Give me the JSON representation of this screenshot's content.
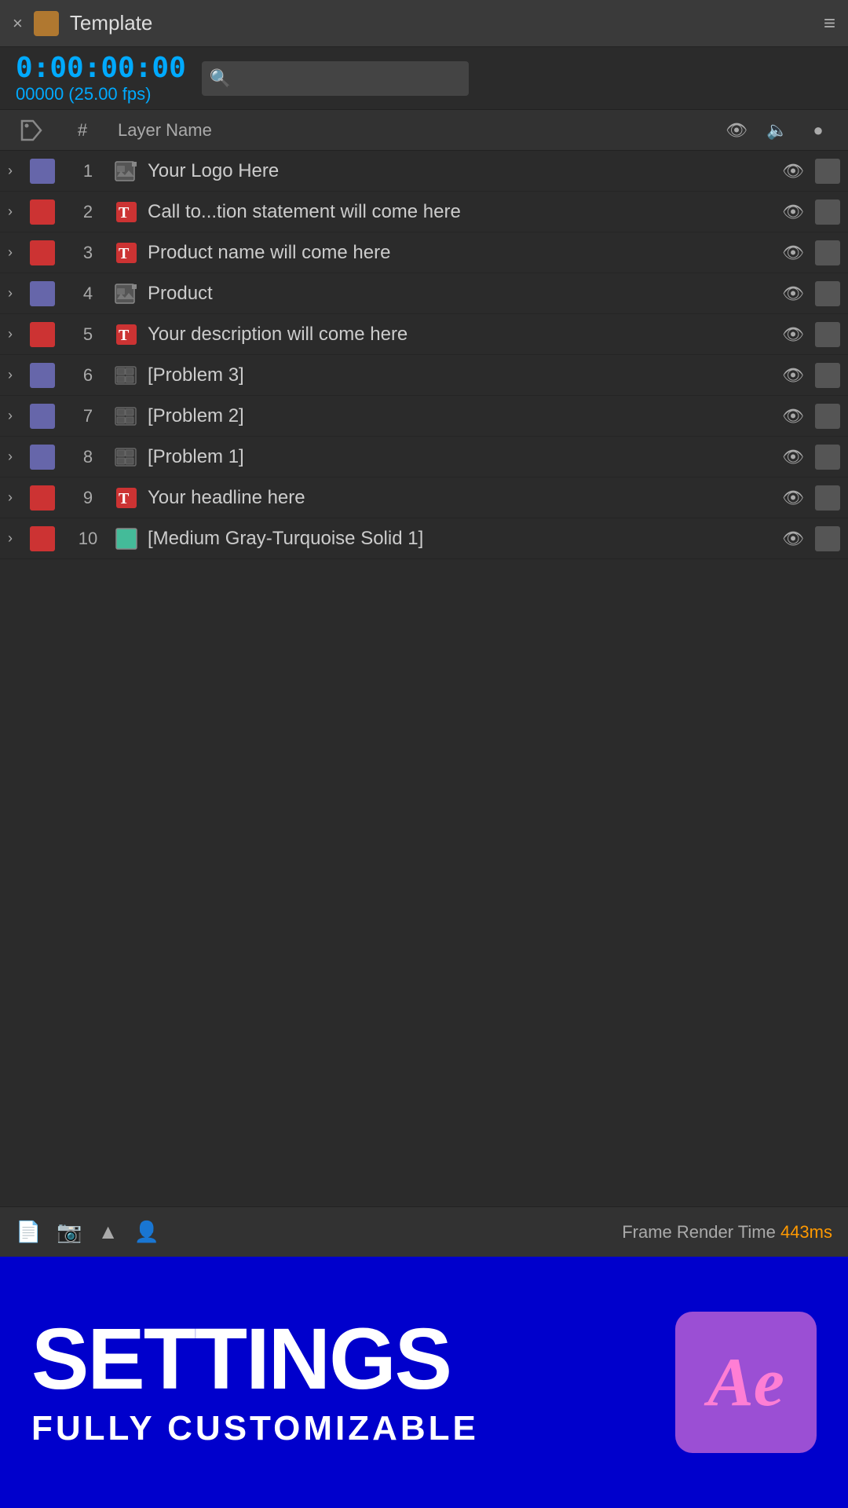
{
  "titleBar": {
    "close": "×",
    "title": "Template",
    "menuIcon": "≡"
  },
  "timecode": {
    "main": "0:00:00:00",
    "sub": "00000 (25.00 fps)"
  },
  "search": {
    "placeholder": ""
  },
  "columnHeaders": {
    "hash": "#",
    "layerName": "Layer Name"
  },
  "layers": [
    {
      "num": "1",
      "color": "#6666aa",
      "type": "image",
      "name": "Your Logo Here",
      "hasEye": true
    },
    {
      "num": "2",
      "color": "#cc3333",
      "type": "text",
      "name": "Call to...tion statement will come here",
      "hasEye": true
    },
    {
      "num": "3",
      "color": "#cc3333",
      "type": "text",
      "name": "Product name will come here",
      "hasEye": true
    },
    {
      "num": "4",
      "color": "#6666aa",
      "type": "image",
      "name": "Product",
      "hasEye": true
    },
    {
      "num": "5",
      "color": "#cc3333",
      "type": "text",
      "name": "Your description will come here",
      "hasEye": true
    },
    {
      "num": "6",
      "color": "#6666aa",
      "type": "precomp",
      "name": "[Problem 3]",
      "hasEye": true
    },
    {
      "num": "7",
      "color": "#6666aa",
      "type": "precomp",
      "name": "[Problem 2]",
      "hasEye": true
    },
    {
      "num": "8",
      "color": "#6666aa",
      "type": "precomp",
      "name": "[Problem 1]",
      "hasEye": true
    },
    {
      "num": "9",
      "color": "#cc3333",
      "type": "text",
      "name": "Your headline here",
      "hasEye": true
    },
    {
      "num": "10",
      "color": "#cc3333",
      "type": "solid",
      "solidColor": "#44bb99",
      "name": "[Medium Gray-Turquoise Solid 1]",
      "hasEye": true
    }
  ],
  "footer": {
    "frameRenderLabel": "Frame Render Time",
    "frameRenderValue": "443ms"
  },
  "banner": {
    "title": "SETTINGS",
    "subtitle": "FULLY CUSTOMIZABLE",
    "aeLogoText": "Ae"
  }
}
